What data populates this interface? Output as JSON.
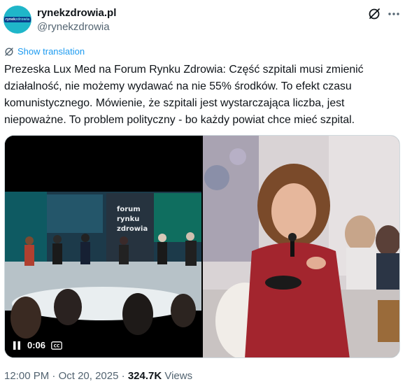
{
  "author": {
    "display_name": "rynekzdrowia.pl",
    "handle": "@rynekzdrowia",
    "avatar_text_a": "rynek",
    "avatar_text_b": "zdrowia"
  },
  "translate": {
    "label": "Show translation"
  },
  "tweet": {
    "text": "Prezeska Lux Med na Forum Rynku Zdrowia: Część szpitali musi zmienić działalność, nie możemy wydawać na nie 55% środków. To efekt czasu komunistycznego. Mówienie, że szpitali jest wystarczająca liczba, jest niepoważne. To problem polityczny - bo każdy powiat chce mieć szpital."
  },
  "video": {
    "time": "0:06",
    "stage_text": "forum\nrynku\nzdrowia"
  },
  "meta": {
    "time": "12:00 PM",
    "sep1": " · ",
    "date": "Oct 20, 2025",
    "sep2": " · ",
    "views": "324.7K",
    "views_label": " Views"
  },
  "colors": {
    "accent": "#1d9bf0",
    "muted": "#536471",
    "text": "#0f1419"
  }
}
